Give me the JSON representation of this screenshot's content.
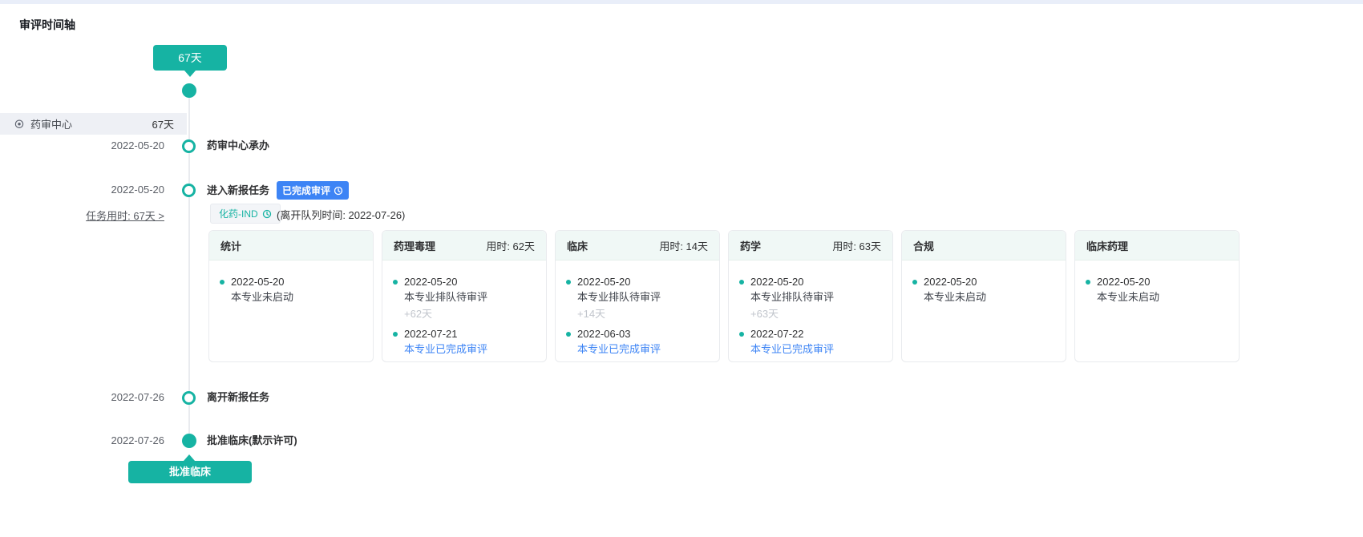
{
  "page_title": "审评时间轴",
  "colors": {
    "teal": "#16b3a3",
    "blue": "#3d84f5"
  },
  "top_tooltip": "67天",
  "org_row": {
    "icon": "location",
    "name": "药审中心",
    "duration": "67天"
  },
  "events": [
    {
      "date": "2022-05-20",
      "title": "药审中心承办",
      "dot": "hollow"
    },
    {
      "date": "2022-05-20",
      "title": "进入新报任务",
      "badge": "已完成审评",
      "task_link": "任务用时: 67天 >",
      "dot": "hollow"
    },
    {
      "date": "2022-07-26",
      "title": "离开新报任务",
      "dot": "hollow"
    },
    {
      "date": "2022-07-26",
      "title": "批准临床(默示许可)",
      "dot": "filled"
    }
  ],
  "task_detail": {
    "tag": "化药-IND",
    "queue_note": "(离开队列时间: 2022-07-26)",
    "cards": [
      {
        "title": "统计",
        "duration": "",
        "entries": [
          {
            "date": "2022-05-20",
            "status": "本专业未启动"
          }
        ],
        "gap": ""
      },
      {
        "title": "药理毒理",
        "duration": "用时: 62天",
        "entries": [
          {
            "date": "2022-05-20",
            "status": "本专业排队待审评"
          },
          {
            "date": "2022-07-21",
            "status": "本专业已完成审评"
          }
        ],
        "gap": "+62天"
      },
      {
        "title": "临床",
        "duration": "用时: 14天",
        "entries": [
          {
            "date": "2022-05-20",
            "status": "本专业排队待审评"
          },
          {
            "date": "2022-06-03",
            "status": "本专业已完成审评"
          }
        ],
        "gap": "+14天"
      },
      {
        "title": "药学",
        "duration": "用时: 63天",
        "entries": [
          {
            "date": "2022-05-20",
            "status": "本专业排队待审评"
          },
          {
            "date": "2022-07-22",
            "status": "本专业已完成审评"
          }
        ],
        "gap": "+63天"
      },
      {
        "title": "合规",
        "duration": "",
        "entries": [
          {
            "date": "2022-05-20",
            "status": "本专业未启动"
          }
        ],
        "gap": ""
      },
      {
        "title": "临床药理",
        "duration": "",
        "entries": [
          {
            "date": "2022-05-20",
            "status": "本专业未启动"
          }
        ],
        "gap": ""
      }
    ]
  },
  "bottom_tooltip": "批准临床"
}
